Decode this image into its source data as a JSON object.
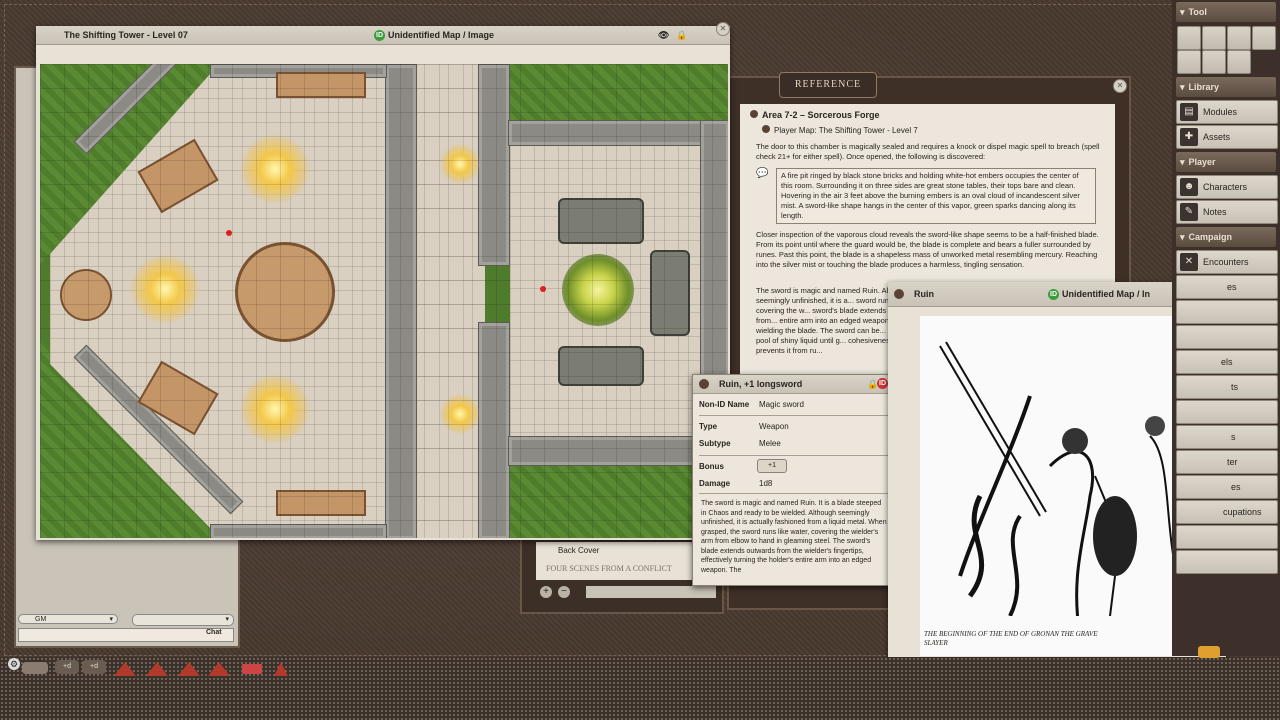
{
  "map_window": {
    "title": "The Shifting Tower - Level 07",
    "status": "Unidentified Map / Image",
    "id_badge": "ID"
  },
  "reference": {
    "tab_label": "REFERENCE",
    "heading": "Area 7-2 – Sorcerous Forge",
    "link": "Player Map: The Shifting Tower - Level 7",
    "para1": "The door to this chamber is magically sealed and requires a knock or dispel magic spell to breach (spell check 21+ for either spell). Once opened, the following is discovered:",
    "boxed": "A fire pit ringed by black stone bricks and holding white-hot embers occupies the center of this room. Surrounding it on three sides are great stone tables, their tops bare and clean. Hovering in the air 3 feet above the burning embers is an oval cloud of incandescent silver mist. A sword-like shape hangs in the center of this vapor, green sparks dancing along its length.",
    "para2": "Closer inspection of the vaporous cloud reveals the sword-like shape seems to be a half-finished blade. From its point until where the guard would be, the blade is complete and bears a fuller surrounded by runes. Past this point, the blade is a shapeless mass of unworked metal resembling mercury. Reaching into the silver mist or touching the blade produces a harmless, tingling sensation.",
    "para3": "The sword is magic and named Ruin. Although seemingly unfinished, it is a... sword runs like water, covering the w... sword's blade extends outwards from... entire arm into an edged weapon. Th... wielding the blade. The sword can be... shapeless pool of shiny liquid until g... cohesiveness that prevents it from ru..."
  },
  "item": {
    "title": "Ruin, +1 longsword",
    "nonid_label": "Non-ID Name",
    "nonid_value": "Magic sword",
    "type_label": "Type",
    "type_value": "Weapon",
    "subtype_label": "Subtype",
    "subtype_value": "Melee",
    "bonus_label": "Bonus",
    "bonus_value": "+1",
    "damage_label": "Damage",
    "damage_value": "1d8",
    "desc": "The sword is magic and named Ruin. It is a blade steeped in Chaos and ready to be wielded. Although seemingly unfinished, it is actually fashioned from a liquid metal. When grasped, the sword runs like water, covering the wielder's arm from elbow to hand in gleaming steel. The sword's blade extends outwards from the wielder's fingertips, effectively turning the holder's entire arm into an edged weapon. The"
  },
  "ruin_window": {
    "title": "Ruin",
    "status": "Unidentified Map / In",
    "caption": "THE BEGINNING OF THE END OF GRONAN THE GRAVE SLAYER"
  },
  "back_panel": {
    "back_cover": "Back Cover",
    "scenes": "FOUR SCENES FROM A CONFLICT"
  },
  "chat": {
    "identity": "GM",
    "chat_button": "Chat"
  },
  "sidebar": {
    "tool_header": "Tool",
    "library_header": "Library",
    "modules": "Modules",
    "assets": "Assets",
    "player_header": "Player",
    "characters": "Characters",
    "notes": "Notes",
    "campaign_header": "Campaign",
    "encounters": "Encounters",
    "partial": [
      "es",
      "els",
      "ts",
      "s",
      "ter",
      "es",
      "cupations"
    ]
  },
  "dice_tray": {
    "mod1": "+d",
    "mod2": "+d",
    "mod3": "+d"
  }
}
